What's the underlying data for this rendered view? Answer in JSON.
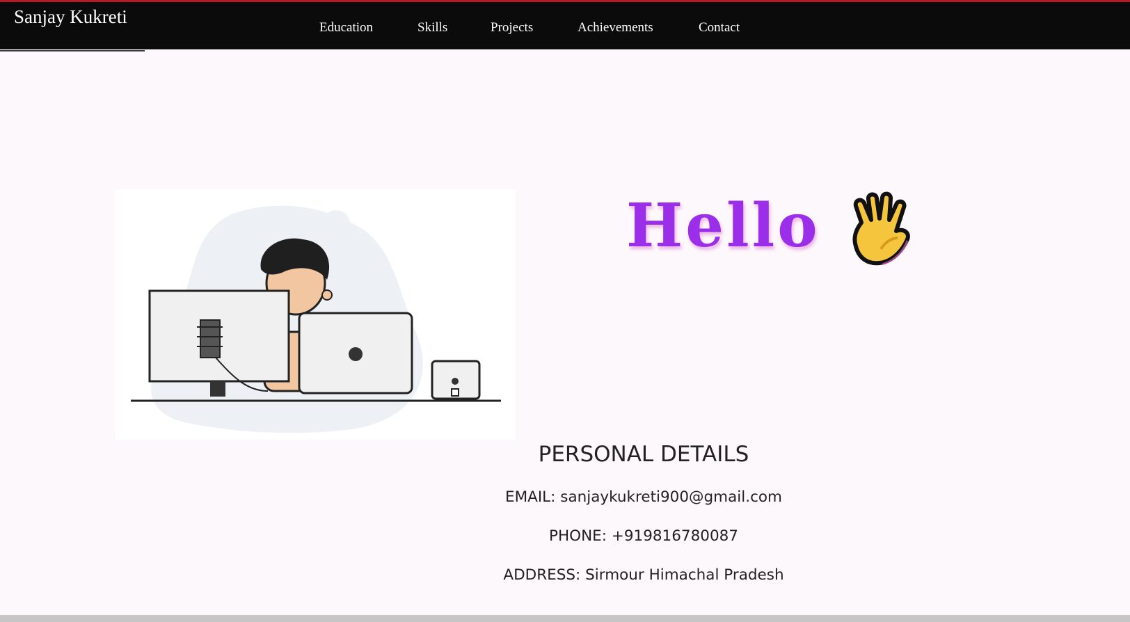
{
  "header": {
    "brand": "Sanjay Kukreti",
    "nav": [
      {
        "label": "Education"
      },
      {
        "label": "Skills"
      },
      {
        "label": "Projects"
      },
      {
        "label": "Achievements"
      },
      {
        "label": "Contact"
      }
    ]
  },
  "hero": {
    "greeting": "Hello",
    "wave_icon": "waving-hand-icon",
    "illustration": "developer-at-desk-illustration"
  },
  "personal_details": {
    "title": "PERSONAL DETAILS",
    "email": "EMAIL: sanjaykukreti900@gmail.com",
    "phone": "PHONE: +919816780087",
    "address": "ADDRESS: Sirmour Himachal Pradesh"
  },
  "colors": {
    "nav_background": "#0b0b0b",
    "top_accent": "#b31b25",
    "greeting": "#9b2ee8",
    "page_background": "#fdf8fb"
  }
}
